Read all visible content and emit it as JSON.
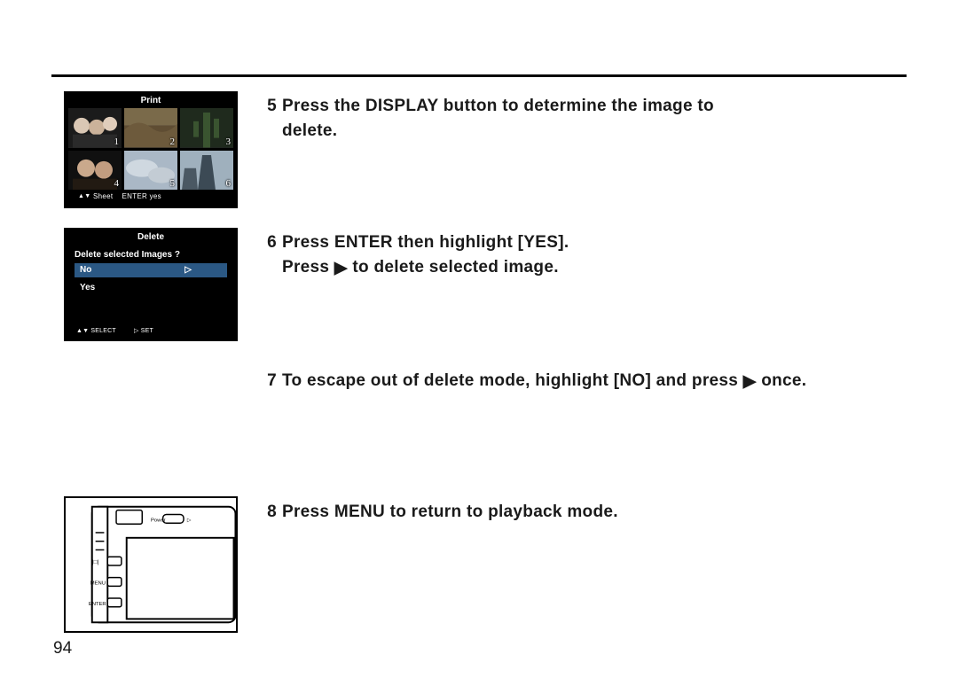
{
  "page_number": "94",
  "lcd1": {
    "title": "Print",
    "footer_left": "Sheet",
    "footer_right": "ENTER yes",
    "thumbs": [
      "1",
      "2",
      "3",
      "4",
      "5",
      "6"
    ]
  },
  "lcd2": {
    "title": "Delete",
    "question": "Delete selected Images ?",
    "opt_no": "No",
    "opt_yes": "Yes",
    "foot_select": "SELECT",
    "foot_set": "SET"
  },
  "steps": {
    "5": {
      "num": "5",
      "line1": "Press the DISPLAY button to determine the image to",
      "line2": "delete."
    },
    "6": {
      "num": "6",
      "line1": "Press ENTER then highlight [YES].",
      "line2a": "Press ",
      "tri": "▶",
      "line2b": "  to delete selected image."
    },
    "7": {
      "num": "7",
      "text_a": "To escape out of delete mode, highlight [NO] and press ",
      "tri": "▶",
      "text_b": "  once."
    },
    "8": {
      "num": "8",
      "text": "Press MENU to return to playback mode."
    }
  },
  "cam_labels": {
    "power": "Power",
    "disp": "|□|",
    "menu": "MENU",
    "enter": "ENTER"
  }
}
